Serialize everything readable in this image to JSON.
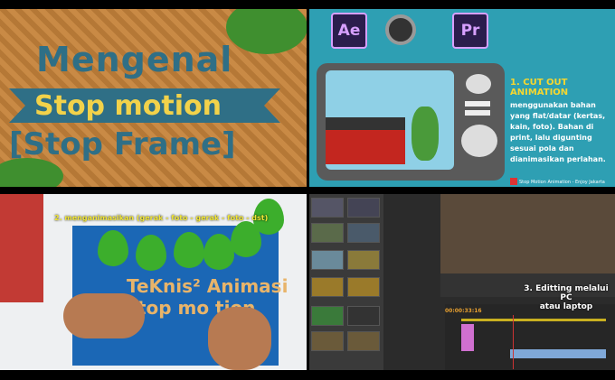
{
  "panel_title": {
    "line1": "Mengenal",
    "line2": "Stop motion",
    "line3": "[Stop Frame]"
  },
  "panel_cutout": {
    "logos": [
      "Ae",
      "Pr"
    ],
    "heading": "1. CUT OUT ANIMATION",
    "description": "menggunakan bahan yang flat/datar (kertas, kain, foto). Bahan di print, lalu digunting sesuai pola dan dianimasikan perlahan.",
    "credit": "Stop Motion Animation - Enjoy Jakarta"
  },
  "panel_animate": {
    "caption": "2. menganimasikan (gerak - foto - gerak - foto - dst)",
    "board_line1": "TeKnis² Animasi",
    "board_line2": "stop mo tion"
  },
  "panel_editing": {
    "caption_line1": "3. Editting melalui PC",
    "caption_line2": "atau laptop",
    "timecode": "00:00:33:16"
  }
}
